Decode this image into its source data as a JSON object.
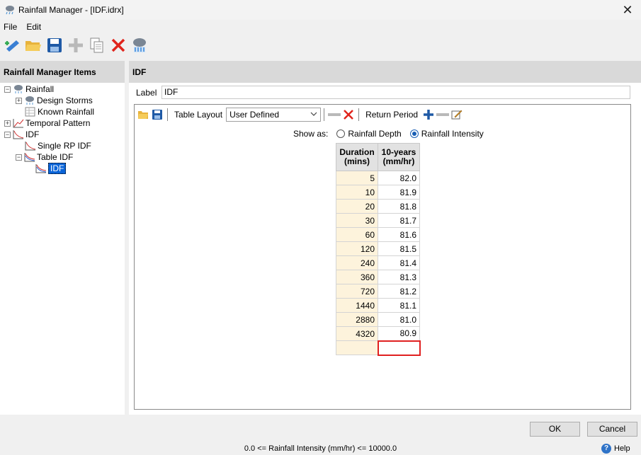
{
  "window": {
    "title": "Rainfall Manager - [IDF.idrx]",
    "close_glyph": "✕"
  },
  "menu": [
    {
      "label": "File"
    },
    {
      "label": "Edit"
    }
  ],
  "toolbar": {
    "icons": [
      "new-item-icon",
      "open-folder-icon",
      "save-icon",
      "add-icon",
      "copy-icon",
      "delete-icon",
      "rain-cloud-icon"
    ]
  },
  "left_panel": {
    "header": "Rainfall Manager Items",
    "tree": [
      {
        "label": "Rainfall"
      },
      {
        "label": "Design Storms"
      },
      {
        "label": "Known Rainfall"
      },
      {
        "label": "Temporal Pattern"
      },
      {
        "label": "IDF"
      },
      {
        "label": "Single RP IDF"
      },
      {
        "label": "Table IDF"
      },
      {
        "label": "IDF"
      }
    ]
  },
  "right_panel": {
    "header": "IDF",
    "label_caption": "Label",
    "label_value": "IDF"
  },
  "editor": {
    "table_layout_label": "Table Layout",
    "table_layout_value": "User Defined",
    "return_period_label": "Return Period",
    "show_as_label": "Show as:",
    "options": [
      {
        "label": "Rainfall Depth",
        "selected": false
      },
      {
        "label": "Rainfall Intensity",
        "selected": true
      }
    ],
    "grid": {
      "col1_line1": "Duration",
      "col1_line2": "(mins)",
      "col2_line1": "10-years",
      "col2_line2": "(mm/hr)",
      "rows": [
        {
          "duration": "5",
          "value": "82.0"
        },
        {
          "duration": "10",
          "value": "81.9"
        },
        {
          "duration": "20",
          "value": "81.8"
        },
        {
          "duration": "30",
          "value": "81.7"
        },
        {
          "duration": "60",
          "value": "81.6"
        },
        {
          "duration": "120",
          "value": "81.5"
        },
        {
          "duration": "240",
          "value": "81.4"
        },
        {
          "duration": "360",
          "value": "81.3"
        },
        {
          "duration": "720",
          "value": "81.2"
        },
        {
          "duration": "1440",
          "value": "81.1"
        },
        {
          "duration": "2880",
          "value": "81.0"
        },
        {
          "duration": "4320",
          "value": "80.9"
        }
      ]
    }
  },
  "buttons": {
    "ok": "OK",
    "cancel": "Cancel"
  },
  "status": "0.0 <= Rainfall Intensity (mm/hr) <= 10000.0",
  "help": {
    "label": "Help",
    "glyph": "?"
  },
  "colors": {
    "accent": "#1a5fb4",
    "selection": "#0a64d8",
    "error_border": "#e02020",
    "duration_cell": "#fdf3dc"
  }
}
